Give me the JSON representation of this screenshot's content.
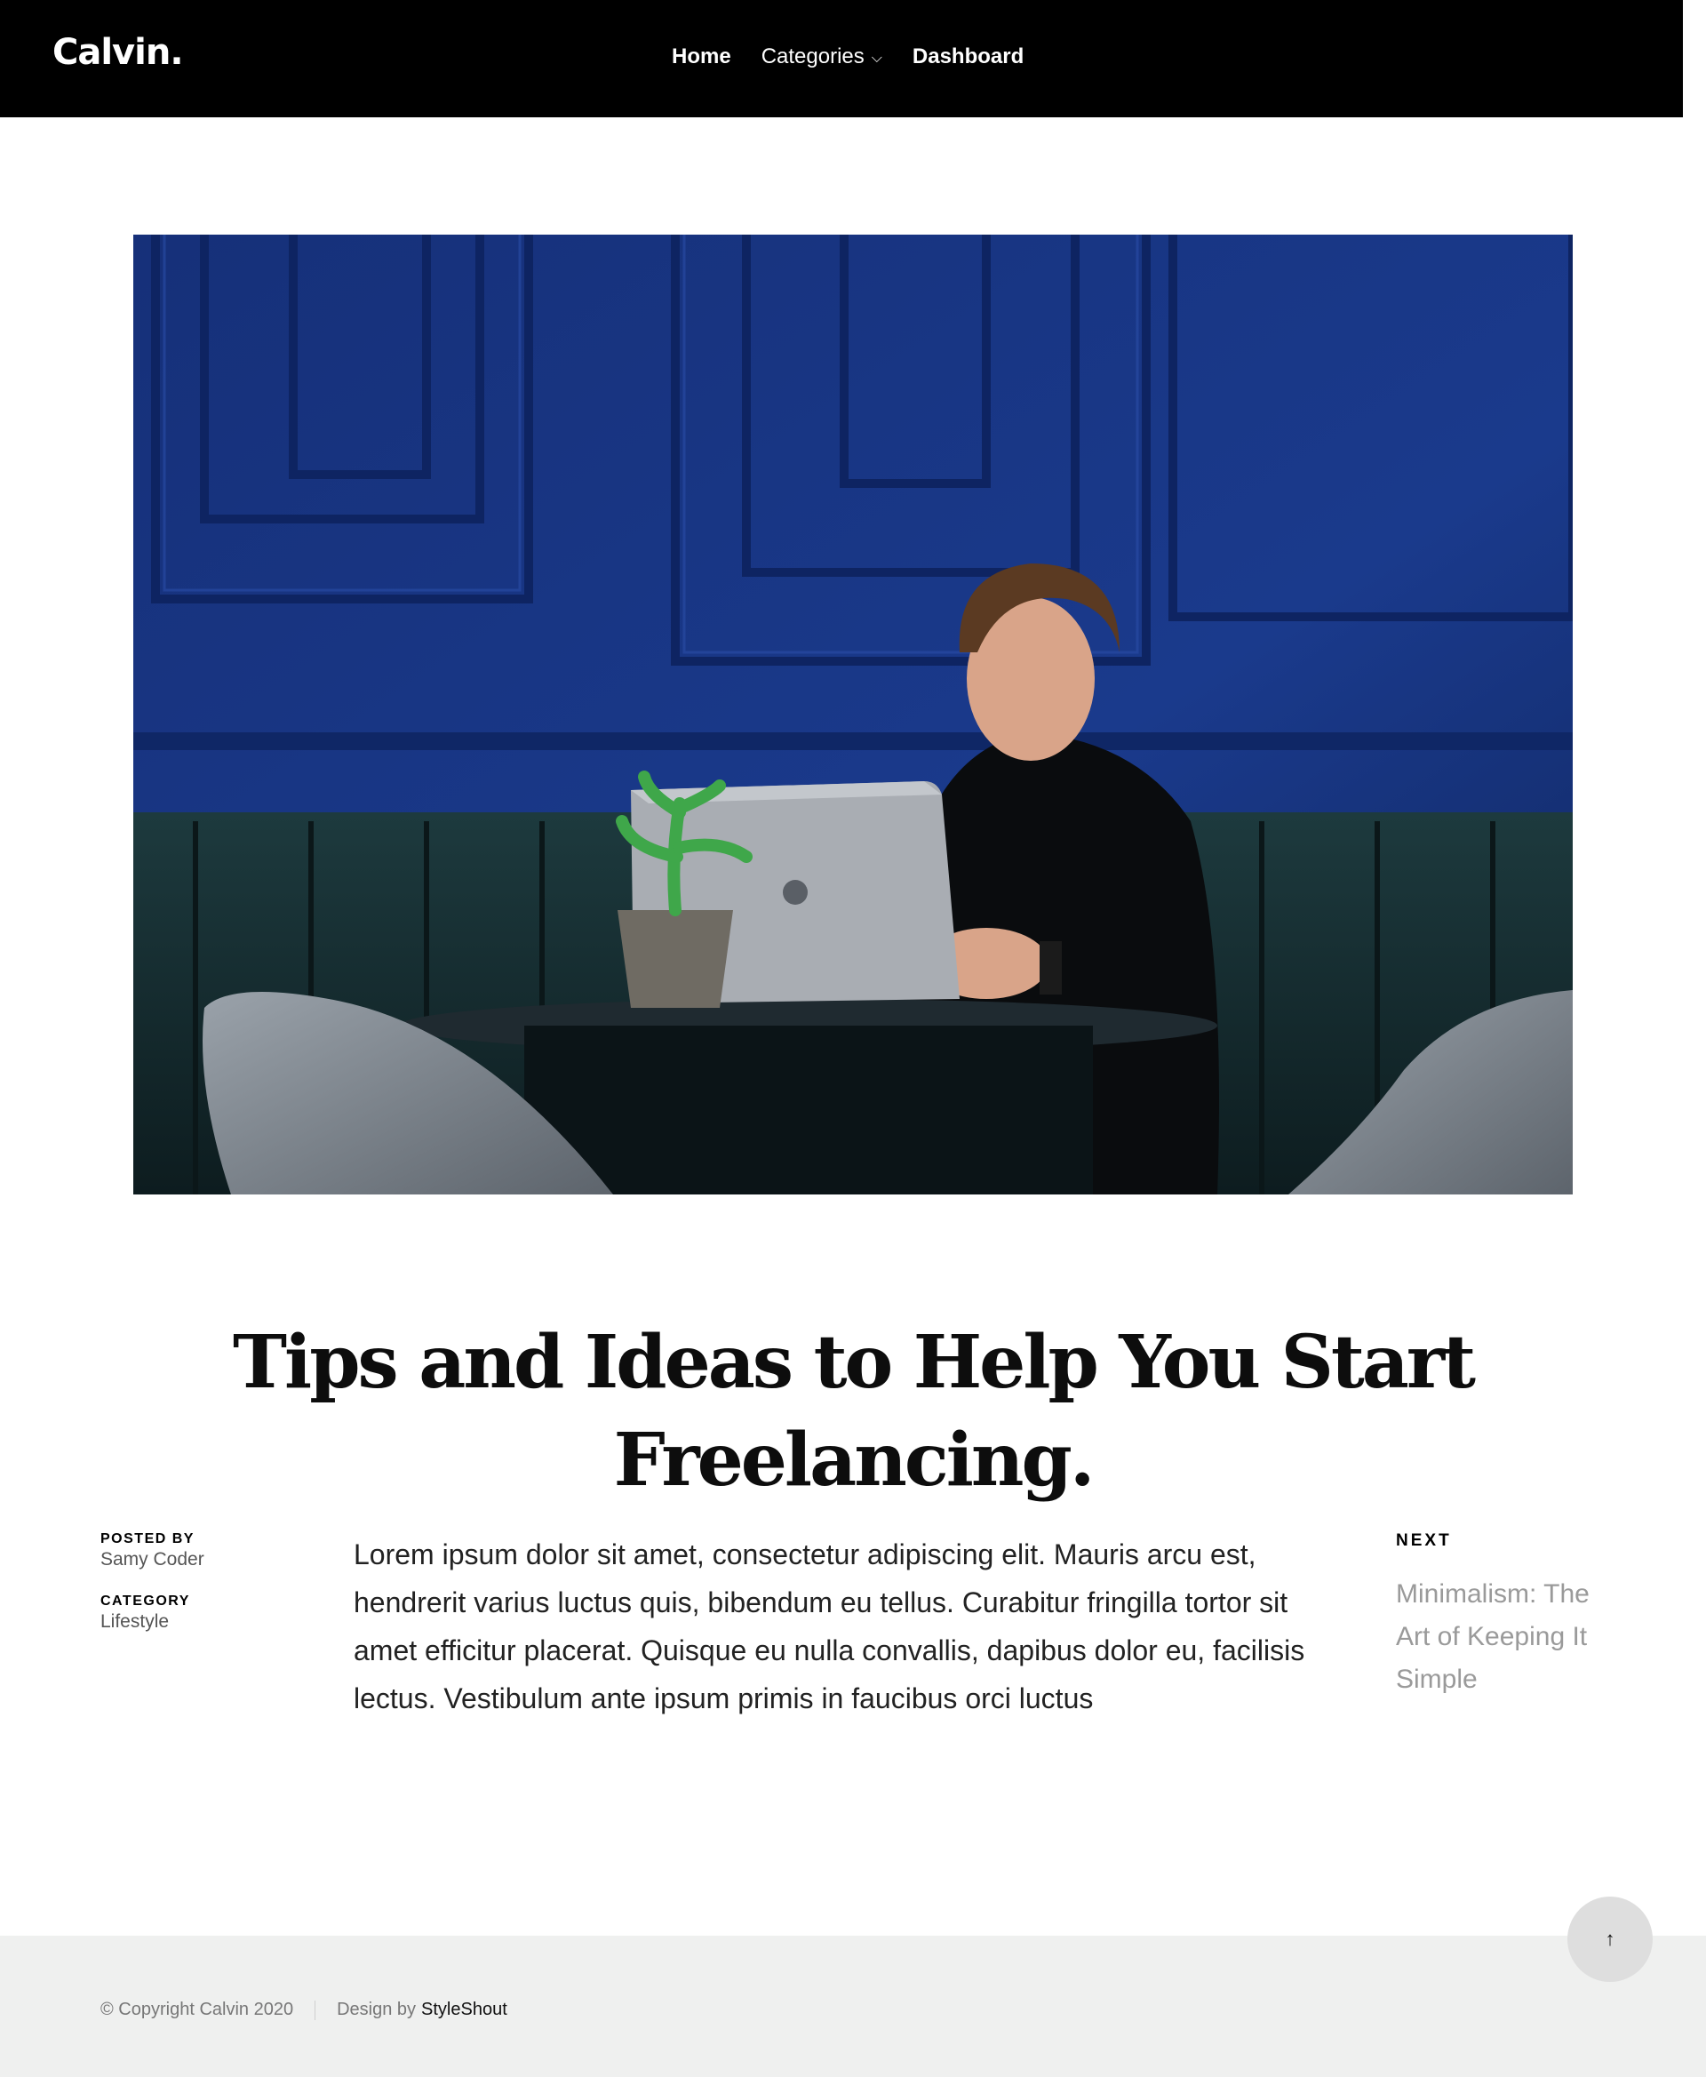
{
  "header": {
    "logo": "Calvin.",
    "nav": [
      {
        "label": "Home"
      },
      {
        "label": "Categories"
      },
      {
        "label": "Dashboard"
      }
    ],
    "dropdown_icon": "chevron-down-icon"
  },
  "article": {
    "title": "Tips and Ideas to Help You Start Freelancing.",
    "posted_by_label": "POSTED BY",
    "author": "Samy Coder",
    "category_label": "CATEGORY",
    "category": "Lifestyle",
    "body": "Lorem ipsum dolor sit amet, consectetur adipiscing elit. Mauris arcu est, hendrerit varius luctus quis, bibendum eu tellus. Curabitur fringilla tortor sit amet efficitur placerat. Quisque eu nulla convallis, dapibus dolor eu, facilisis lectus. Vestibulum ante ipsum primis in faucibus orci luctus"
  },
  "next": {
    "label": "NEXT",
    "title": "Minimalism: The Art of Keeping It Simple"
  },
  "back_to_top": {
    "icon": "arrow-up-icon",
    "glyph": "↑"
  },
  "footer": {
    "copyright": "© Copyright Calvin 2020",
    "design_by": "Design by",
    "design_link": "StyleShout"
  },
  "colors": {
    "header_bg": "#000000",
    "wall_blue": "#18327a",
    "footer_bg": "#eff0ef",
    "next_link": "#9a9a9a"
  }
}
